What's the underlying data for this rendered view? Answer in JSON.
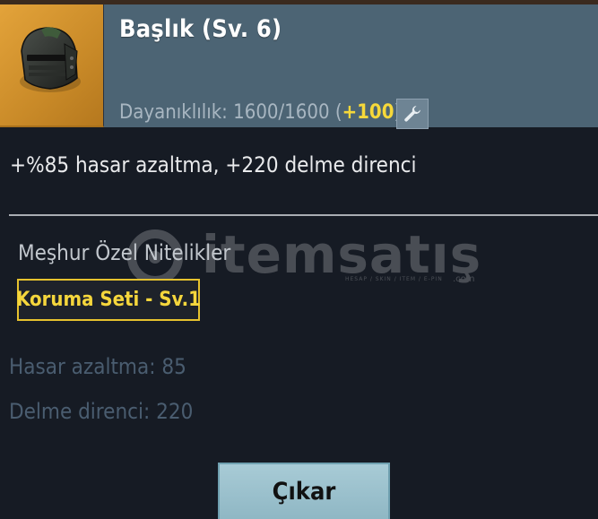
{
  "item": {
    "title": "Başlık (Sv. 6)",
    "durability_label": "Dayanıklılık:",
    "durability_value": "1600/1600",
    "durability_bonus_open": "(",
    "durability_bonus": "+100",
    "durability_bonus_close": ")",
    "effect": "+%85 hasar azaltma, +220 delme direnci"
  },
  "special_attributes": {
    "title": "Meşhur Özel Nitelikler",
    "set_name": "Koruma Seti - Sv.1"
  },
  "stats": [
    "Hasar azaltma: 85",
    "Delme direnci: 220"
  ],
  "actions": {
    "remove_label": "Çıkar"
  },
  "watermark": {
    "brand": "itemsatış",
    "tagline": "HESAP / SKIN / ITEM / E-PIN",
    "suffix": ".com"
  },
  "icons": {
    "item_icon": "helmet-icon",
    "repair_icon": "wrench-icon"
  },
  "colors": {
    "header_bg": "#4c6474",
    "thumb_bg": "#d9972f",
    "bonus_yellow": "#f6d83a",
    "set_gold": "#e6c22e",
    "stat_muted": "#4a5d70",
    "button_bg": "#9cc2ce"
  }
}
